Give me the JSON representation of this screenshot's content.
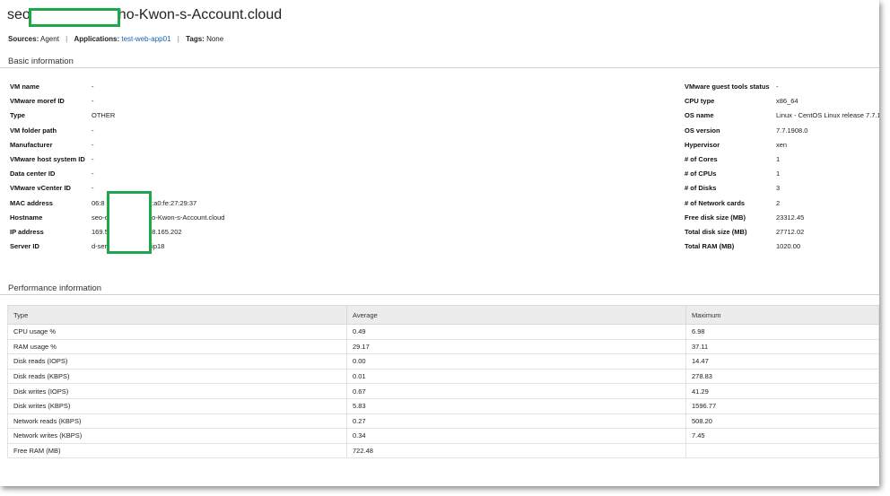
{
  "title": {
    "prefix": "seo",
    "suffix": "ho-Kwon-s-Account.cloud"
  },
  "meta": {
    "sources_label": "Sources:",
    "sources_value": "Agent",
    "applications_label": "Applications:",
    "applications_value": "test-web-app01",
    "tags_label": "Tags:",
    "tags_value": "None",
    "separator": "|"
  },
  "basic": {
    "heading": "Basic information",
    "left": [
      {
        "key": "VM name",
        "value": "-"
      },
      {
        "key": "VMware moref ID",
        "value": "-"
      },
      {
        "key": "Type",
        "value": "OTHER"
      },
      {
        "key": "VM folder path",
        "value": "-"
      },
      {
        "key": "Manufacturer",
        "value": "-"
      },
      {
        "key": "VMware host system ID",
        "value": "-"
      },
      {
        "key": "Data center ID",
        "value": "-"
      },
      {
        "key": "VMware vCenter ID",
        "value": "-"
      },
      {
        "key": "MAC address",
        "value": "06:8",
        "value_tail": "6:a0:fe:27:29:37"
      },
      {
        "key": "Hostname",
        "value": "seo-c",
        "value_tail": "ho-Kwon-s-Account.cloud"
      },
      {
        "key": "IP address",
        "value": "169.5",
        "value_tail": "78.165.202"
      },
      {
        "key": "Server ID",
        "value": "d-ser",
        "value_tail": "nip18"
      }
    ],
    "right": [
      {
        "key": "VMware guest tools status",
        "value": "-"
      },
      {
        "key": "CPU type",
        "value": "x86_64"
      },
      {
        "key": "OS name",
        "value": "Linux - CentOS Linux release 7.7.1"
      },
      {
        "key": "OS version",
        "value": "7.7.1908.0"
      },
      {
        "key": "Hypervisor",
        "value": "xen"
      },
      {
        "key": "# of Cores",
        "value": "1"
      },
      {
        "key": "# of CPUs",
        "value": "1"
      },
      {
        "key": "# of Disks",
        "value": "3"
      },
      {
        "key": "# of Network cards",
        "value": "2"
      },
      {
        "key": "Free disk size (MB)",
        "value": "23312.45"
      },
      {
        "key": "Total disk size (MB)",
        "value": "27712.02"
      },
      {
        "key": "Total RAM (MB)",
        "value": "1020.00"
      }
    ]
  },
  "performance": {
    "heading": "Performance information",
    "columns": [
      "Type",
      "Average",
      "Maximum"
    ],
    "rows": [
      [
        "CPU usage %",
        "0.49",
        "6.98"
      ],
      [
        "RAM usage %",
        "29.17",
        "37.11"
      ],
      [
        "Disk reads (IOPS)",
        "0.00",
        "14.47"
      ],
      [
        "Disk reads (KBPS)",
        "0.01",
        "278.83"
      ],
      [
        "Disk writes (IOPS)",
        "0.67",
        "41.29"
      ],
      [
        "Disk writes (KBPS)",
        "5.83",
        "1596.77"
      ],
      [
        "Network reads (KBPS)",
        "0.27",
        "508.20"
      ],
      [
        "Network writes (KBPS)",
        "0.34",
        "7.45"
      ],
      [
        "Free RAM (MB)",
        "722.48",
        ""
      ]
    ]
  },
  "colors": {
    "redaction_border": "#1fa84a",
    "link": "#1a5fb4"
  }
}
